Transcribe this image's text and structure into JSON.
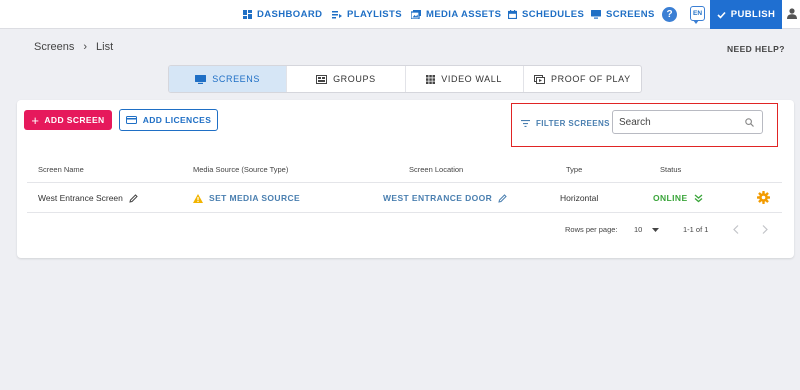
{
  "nav": {
    "items": [
      {
        "label": "DASHBOARD",
        "icon": "dashboard-icon"
      },
      {
        "label": "PLAYLISTS",
        "icon": "playlists-icon"
      },
      {
        "label": "MEDIA ASSETS",
        "icon": "media-assets-icon"
      },
      {
        "label": "SCHEDULES",
        "icon": "calendar-icon"
      },
      {
        "label": "SCREENS",
        "icon": "monitor-icon"
      }
    ],
    "help": "?",
    "lang": "EN",
    "publish": "PUBLISH"
  },
  "breadcrumb": {
    "root": "Screens",
    "sep": "›",
    "current": "List"
  },
  "need_help": "NEED HELP?",
  "tabs": [
    {
      "label": "SCREENS",
      "active": true
    },
    {
      "label": "GROUPS",
      "active": false
    },
    {
      "label": "VIDEO WALL",
      "active": false
    },
    {
      "label": "PROOF OF PLAY",
      "active": false
    }
  ],
  "toolbar": {
    "add_screen": "ADD SCREEN",
    "add_licences": "ADD LICENCES",
    "filter_label": "FILTER SCREENS",
    "search_placeholder": "Search"
  },
  "table": {
    "headers": [
      "Screen Name",
      "Media Source (Source Type)",
      "Screen Location",
      "Type",
      "Status"
    ],
    "rows": [
      {
        "name": "West Entrance Screen",
        "media_source": "SET MEDIA SOURCE",
        "location": "WEST ENTRANCE DOOR",
        "type": "Horizontal",
        "status": "ONLINE"
      }
    ]
  },
  "pagination": {
    "rows_label": "Rows per page:",
    "rows_value": "10",
    "range": "1-1 of 1"
  },
  "colors": {
    "primary": "#1f6fd1",
    "accent_pink": "#e6195c",
    "online": "#3aa53a",
    "warning": "#f2b400",
    "gear": "#f29b00",
    "highlight_box": "#e02424"
  }
}
